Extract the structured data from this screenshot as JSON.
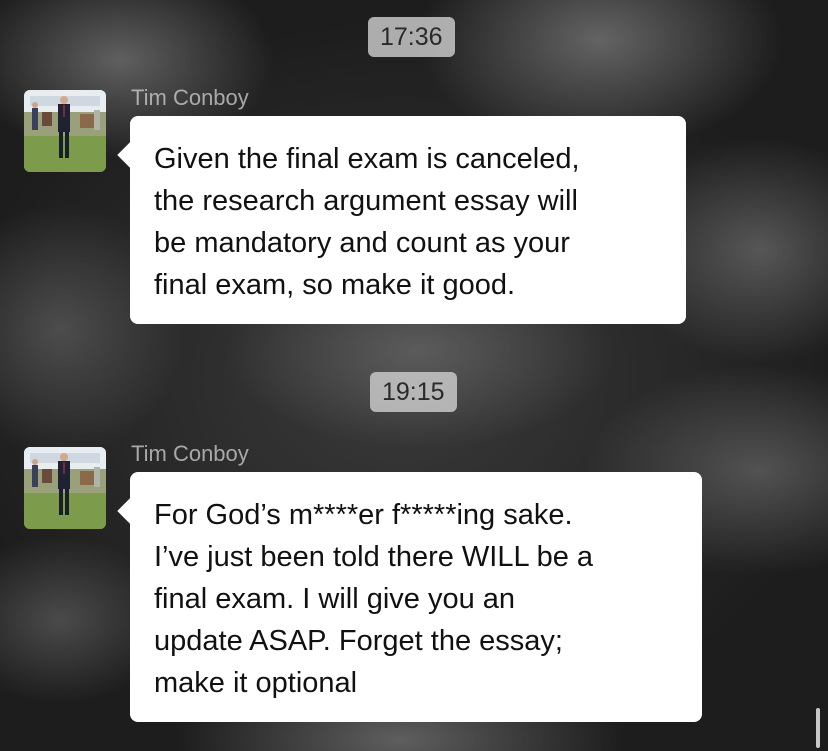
{
  "messages": [
    {
      "timestamp": "17:36",
      "sender": "Tim Conboy",
      "text": "Given the final exam is canceled,\nthe research argument essay will\nbe mandatory and count as your\nfinal exam, so make it good."
    },
    {
      "timestamp": "19:15",
      "sender": "Tim Conboy",
      "text": "For God’s m****er f*****ing sake.\nI’ve just been told there WILL be a\nfinal exam. I will give you an\nupdate ASAP. Forget the essay;\nmake it optional"
    }
  ],
  "colors": {
    "bubble": "#ffffff",
    "timestamp_bg": "#cdcdcd",
    "sender_name": "#d2d2d2",
    "text": "#111111"
  },
  "icons": {
    "avatar": "person-photo-avatar"
  }
}
